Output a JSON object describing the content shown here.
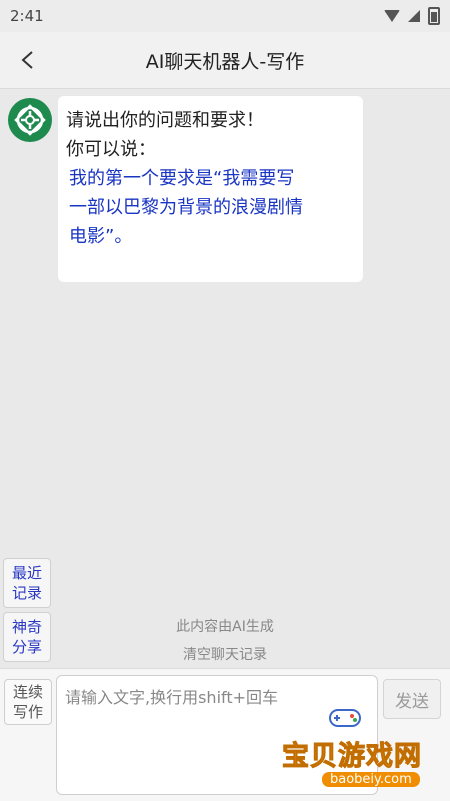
{
  "status": {
    "time": "2:41"
  },
  "header": {
    "title": "AI聊天机器人-写作"
  },
  "chat": {
    "greeting": "请说出你的问题和要求！",
    "prompt": "你可以说：",
    "example_line1": "我的第一个要求是“我需要写",
    "example_line2": "一部以巴黎为背景的浪漫剧情",
    "example_line3": "电影”。"
  },
  "side": {
    "recent_line1": "最近",
    "recent_line2": "记录",
    "magic_line1": "神奇",
    "magic_line2": "分享"
  },
  "notes": {
    "ai_generated": "此内容由AI生成",
    "clear_chat": "清空聊天记录"
  },
  "input": {
    "continue_line1": "连续",
    "continue_line2": "写作",
    "placeholder": "请输入文字,换行用shift+回车",
    "send": "发送"
  },
  "watermark": {
    "title": "宝贝游戏网",
    "url": "baobeiy.com"
  },
  "colors": {
    "accent": "#1a35c4",
    "avatar": "#1e8a4d"
  }
}
